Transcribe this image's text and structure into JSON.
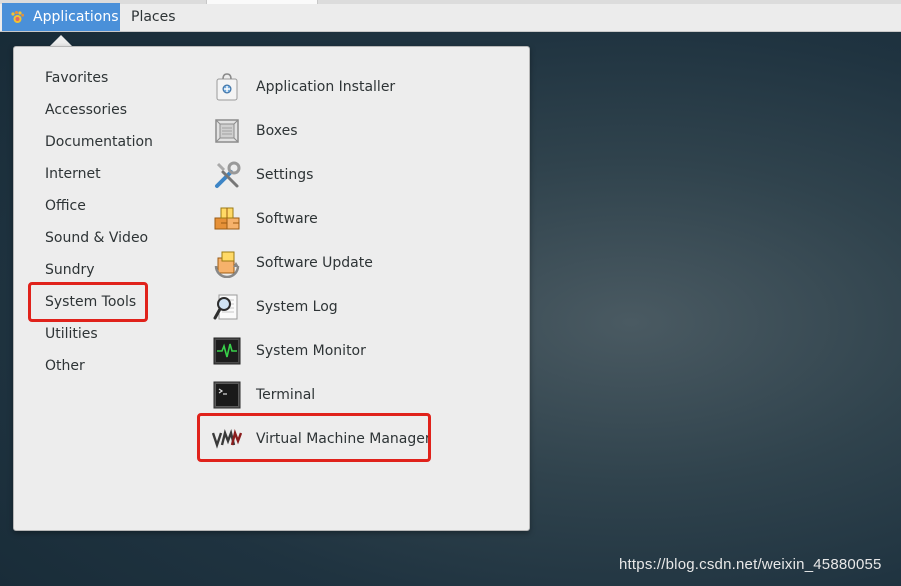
{
  "topbar": {
    "applications_label": "Applications",
    "places_label": "Places"
  },
  "menu": {
    "categories": [
      {
        "label": "Favorites"
      },
      {
        "label": "Accessories"
      },
      {
        "label": "Documentation"
      },
      {
        "label": "Internet"
      },
      {
        "label": "Office"
      },
      {
        "label": "Sound & Video"
      },
      {
        "label": "Sundry"
      },
      {
        "label": "System Tools",
        "highlighted": true
      },
      {
        "label": "Utilities"
      },
      {
        "label": "Other"
      }
    ],
    "apps": [
      {
        "label": "Application Installer",
        "icon": "application-installer-icon"
      },
      {
        "label": "Boxes",
        "icon": "boxes-icon"
      },
      {
        "label": "Settings",
        "icon": "settings-tools-icon"
      },
      {
        "label": "Software",
        "icon": "software-packages-icon"
      },
      {
        "label": "Software Update",
        "icon": "software-update-icon"
      },
      {
        "label": "System Log",
        "icon": "system-log-magnifier-icon"
      },
      {
        "label": "System Monitor",
        "icon": "system-monitor-icon"
      },
      {
        "label": "Terminal",
        "icon": "terminal-icon"
      },
      {
        "label": "Virtual Machine Manager",
        "icon": "vmm-icon",
        "highlighted": true
      }
    ]
  },
  "annotation_color": "#e0221b",
  "accent_color": "#4a90d9",
  "watermark": "https://blog.csdn.net/weixin_45880055"
}
